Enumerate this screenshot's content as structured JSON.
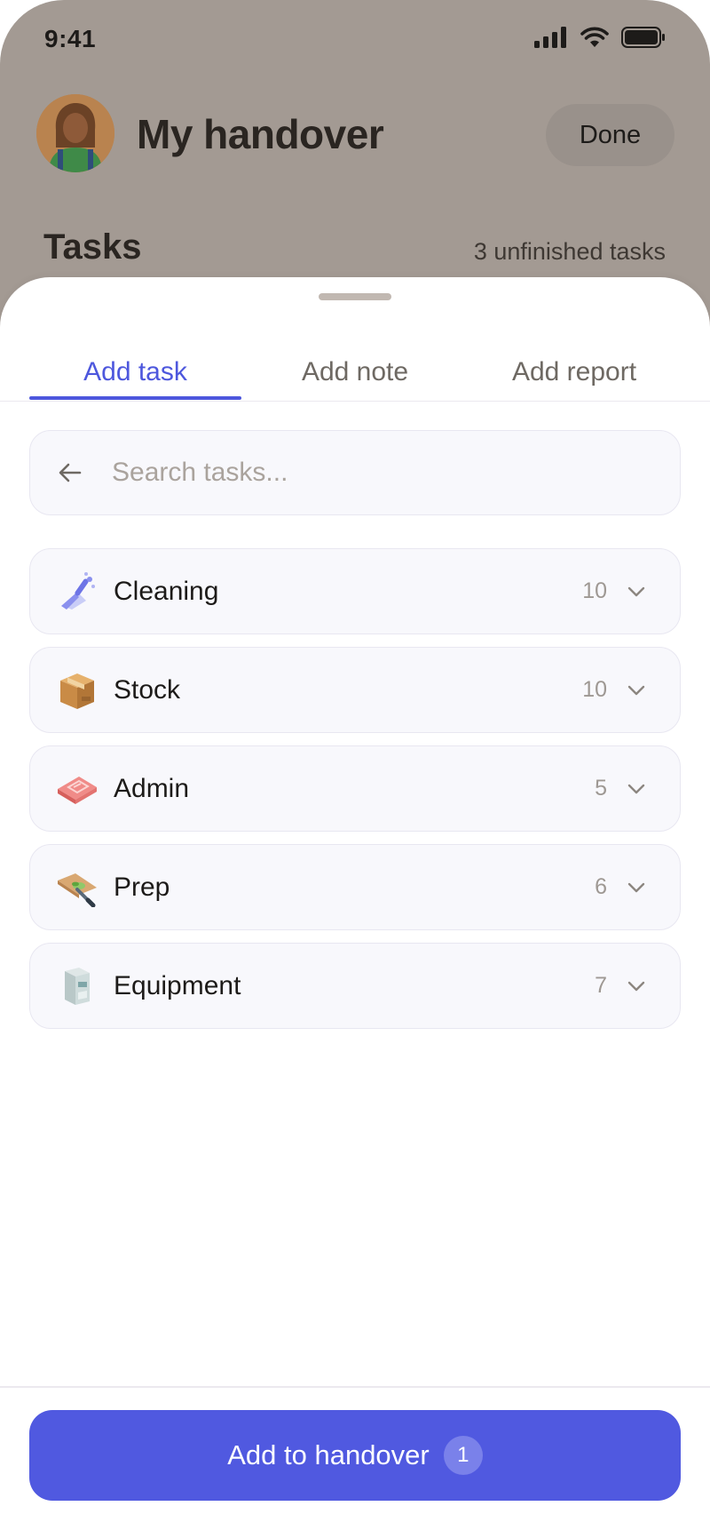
{
  "status_bar": {
    "time": "9:41",
    "icons": [
      "signal-icon",
      "wifi-icon",
      "battery-icon"
    ]
  },
  "header": {
    "title": "My handover",
    "done_label": "Done",
    "avatar_icon": "user-avatar"
  },
  "section": {
    "title": "Tasks",
    "meta": "3 unfinished tasks"
  },
  "sheet": {
    "tabs": [
      {
        "label": "Add task",
        "active": true
      },
      {
        "label": "Add note",
        "active": false
      },
      {
        "label": "Add report",
        "active": false
      }
    ],
    "search": {
      "placeholder": "Search tasks...",
      "value": ""
    },
    "categories": [
      {
        "label": "Cleaning",
        "count": "10",
        "icon": "cleaning-icon"
      },
      {
        "label": "Stock",
        "count": "10",
        "icon": "box-icon"
      },
      {
        "label": "Admin",
        "count": "5",
        "icon": "paperwork-icon"
      },
      {
        "label": "Prep",
        "count": "6",
        "icon": "cutting-board-icon"
      },
      {
        "label": "Equipment",
        "count": "7",
        "icon": "coffee-machine-icon"
      }
    ],
    "cta": {
      "label": "Add to handover",
      "badge": "1"
    }
  },
  "colors": {
    "accent": "#4d57dd",
    "cta_bg": "#5059e0",
    "backdrop": "#a39a93",
    "card_bg": "#f8f8fc"
  }
}
